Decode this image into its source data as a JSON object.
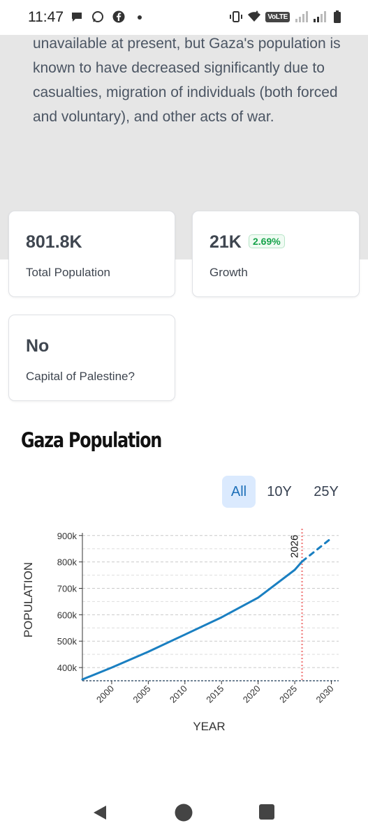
{
  "status_bar": {
    "time": "11:47",
    "left_icons": [
      "chat-bubble-icon",
      "whatsapp-icon",
      "facebook-icon",
      "dot-icon"
    ],
    "right_icons": [
      "vibrate-icon",
      "wifi-icon",
      "volte-icon",
      "signal-icon",
      "signal-icon",
      "battery-icon"
    ],
    "volte_label": "VoLTE"
  },
  "article": {
    "text": "unavailable at present, but Gaza's population is known to have decreased significantly due to casualties, migration of individuals (both forced and voluntary), and other acts of war."
  },
  "stats": {
    "total_population": {
      "value": "801.8K",
      "label": "Total Population"
    },
    "growth": {
      "value": "21K",
      "badge": "2.69%",
      "label": "Growth"
    },
    "capital": {
      "value": "No",
      "label": "Capital of Palestine?"
    }
  },
  "chart_section": {
    "title": "Gaza Population",
    "ranges": [
      "All",
      "10Y",
      "25Y"
    ],
    "active_range": "All"
  },
  "chart_data": {
    "type": "line",
    "xlabel": "YEAR",
    "ylabel": "POPULATION",
    "x_ticks": [
      "2000",
      "2005",
      "2010",
      "2015",
      "2020",
      "2025",
      "2030"
    ],
    "y_ticks": [
      "400k",
      "500k",
      "600k",
      "700k",
      "800k",
      "900k"
    ],
    "xlim": [
      1996,
      2031
    ],
    "ylim": [
      350000,
      910000
    ],
    "marker_year": 2026,
    "marker_label": "2026",
    "grid": true,
    "series": [
      {
        "style": "solid",
        "color": "#1a7fc1",
        "x": [
          1996,
          2000,
          2005,
          2010,
          2015,
          2020,
          2025,
          2026
        ],
        "y": [
          355000,
          400000,
          460000,
          525000,
          590000,
          665000,
          770000,
          801800
        ]
      },
      {
        "style": "dashed",
        "color": "#1a7fc1",
        "x": [
          2026,
          2030
        ],
        "y": [
          801800,
          890000
        ]
      }
    ]
  },
  "colors": {
    "accent": "#1a7fc1",
    "growth_green": "#16a34a",
    "marker_red": "#f28b8b",
    "page_gray": "#e6e6e6"
  },
  "nav": {
    "buttons": [
      "back-icon",
      "home-icon",
      "recents-icon"
    ]
  }
}
